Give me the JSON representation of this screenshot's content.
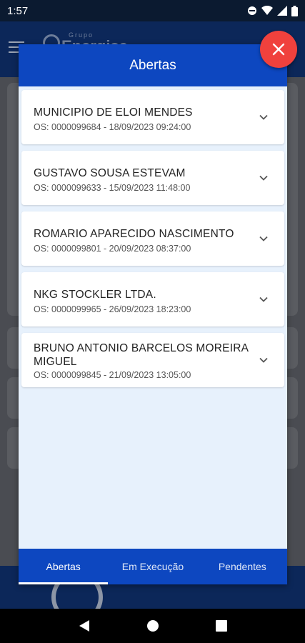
{
  "status_bar": {
    "time": "1:57"
  },
  "background_app": {
    "logo_small": "Grupo",
    "logo_word": "Energisa"
  },
  "modal": {
    "title": "Abertas",
    "items": [
      {
        "name": "MUNICIPIO DE ELOI MENDES",
        "os": "OS: 0000099684 - 18/09/2023 09:24:00"
      },
      {
        "name": "GUSTAVO SOUSA ESTEVAM",
        "os": "OS: 0000099633 - 15/09/2023 11:48:00"
      },
      {
        "name": "ROMARIO APARECIDO NASCIMENTO",
        "os": "OS: 0000099801 - 20/09/2023 08:37:00"
      },
      {
        "name": "NKG STOCKLER LTDA.",
        "os": "OS: 0000099965 - 26/09/2023 18:23:00"
      },
      {
        "name": "BRUNO ANTONIO BARCELOS MOREIRA MIGUEL",
        "os": "OS: 0000099845 - 21/09/2023 13:05:00"
      }
    ],
    "tabs": [
      {
        "label": "Abertas",
        "active": true
      },
      {
        "label": "Em Execução",
        "active": false
      },
      {
        "label": "Pendentes",
        "active": false
      }
    ]
  },
  "colors": {
    "primary": "#0d47c0",
    "close_fab": "#f0413d",
    "modal_bg": "#e7f1fc"
  },
  "icons": {
    "close": "close-icon",
    "chevron": "chevron-down-icon"
  }
}
